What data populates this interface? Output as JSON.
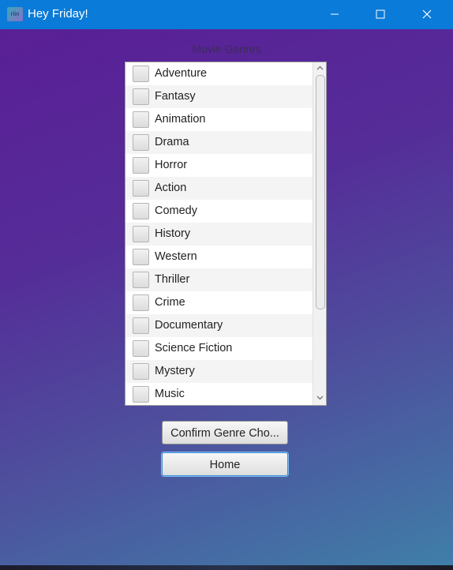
{
  "window": {
    "title": "Hey Friday!",
    "icon": "app-icon",
    "icon_text": "rlin",
    "controls": [
      "minimize-icon",
      "maximize-icon",
      "close-icon"
    ],
    "accent_color": "#0a7bd8"
  },
  "genres": {
    "label": "Movie Genres",
    "items": [
      {
        "label": "Adventure",
        "checked": false
      },
      {
        "label": "Fantasy",
        "checked": false
      },
      {
        "label": "Animation",
        "checked": false
      },
      {
        "label": "Drama",
        "checked": false
      },
      {
        "label": "Horror",
        "checked": false
      },
      {
        "label": "Action",
        "checked": false
      },
      {
        "label": "Comedy",
        "checked": false
      },
      {
        "label": "History",
        "checked": false
      },
      {
        "label": "Western",
        "checked": false
      },
      {
        "label": "Thriller",
        "checked": false
      },
      {
        "label": "Crime",
        "checked": false
      },
      {
        "label": "Documentary",
        "checked": false
      },
      {
        "label": "Science Fiction",
        "checked": false
      },
      {
        "label": "Mystery",
        "checked": false
      },
      {
        "label": "Music",
        "checked": false
      }
    ]
  },
  "buttons": {
    "confirm_label": "Confirm Genre Cho...",
    "home_label": "Home"
  },
  "colors": {
    "gradient_start": "#5a1f96",
    "gradient_end": "#3f7fa8"
  }
}
